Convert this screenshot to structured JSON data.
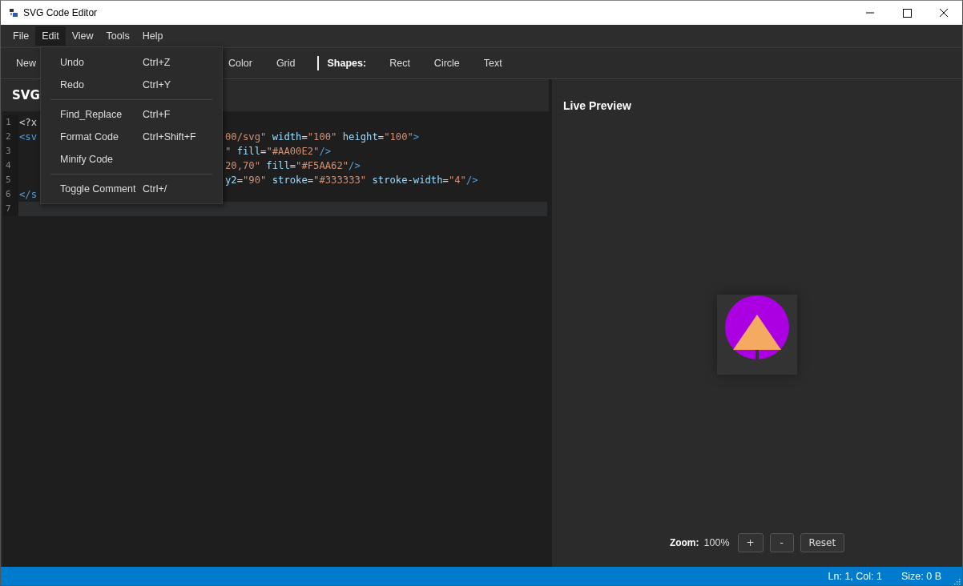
{
  "window": {
    "title": "SVG Code Editor"
  },
  "menu_bar": [
    {
      "label": "File",
      "selected": false
    },
    {
      "label": "Edit",
      "selected": true
    },
    {
      "label": "View",
      "selected": false
    },
    {
      "label": "Tools",
      "selected": false
    },
    {
      "label": "Help",
      "selected": false
    }
  ],
  "toolbar": [
    {
      "kind": "button",
      "label": "New"
    },
    {
      "kind": "gap"
    },
    {
      "kind": "button",
      "label": "Color"
    },
    {
      "kind": "button",
      "label": "Grid"
    },
    {
      "kind": "separator"
    },
    {
      "kind": "heading",
      "label": "Shapes:"
    },
    {
      "kind": "button",
      "label": "Rect"
    },
    {
      "kind": "button",
      "label": "Circle"
    },
    {
      "kind": "button",
      "label": "Text"
    }
  ],
  "editor": {
    "title": "SVG",
    "lines": [
      {
        "number": "1",
        "current": false,
        "left": [
          {
            "kind": "punct",
            "text": "<?x"
          }
        ]
      },
      {
        "number": "2",
        "current": false,
        "left": [
          {
            "kind": "tag",
            "text": "<sv"
          }
        ],
        "right": [
          {
            "kind": "value",
            "text": "00/svg\""
          },
          {
            "kind": "attr",
            "text": " width"
          },
          {
            "kind": "punct",
            "text": "="
          },
          {
            "kind": "value",
            "text": "\"100\""
          },
          {
            "kind": "attr",
            "text": " height"
          },
          {
            "kind": "punct",
            "text": "="
          },
          {
            "kind": "value",
            "text": "\"100\""
          },
          {
            "kind": "tag",
            "text": ">"
          }
        ]
      },
      {
        "number": "3",
        "current": false,
        "right": [
          {
            "kind": "value",
            "text": "\""
          },
          {
            "kind": "attr",
            "text": " fill"
          },
          {
            "kind": "punct",
            "text": "="
          },
          {
            "kind": "value",
            "text": "\"#AA00E2\""
          },
          {
            "kind": "tag",
            "text": "/>"
          }
        ]
      },
      {
        "number": "4",
        "current": false,
        "right": [
          {
            "kind": "value",
            "text": "20,70\""
          },
          {
            "kind": "attr",
            "text": " fill"
          },
          {
            "kind": "punct",
            "text": "="
          },
          {
            "kind": "value",
            "text": "\"#F5AA62\""
          },
          {
            "kind": "tag",
            "text": "/>"
          }
        ]
      },
      {
        "number": "5",
        "current": false,
        "right": [
          {
            "kind": "attr",
            "text": "y2"
          },
          {
            "kind": "punct",
            "text": "="
          },
          {
            "kind": "value",
            "text": "\"90\""
          },
          {
            "kind": "attr",
            "text": " stroke"
          },
          {
            "kind": "punct",
            "text": "="
          },
          {
            "kind": "value",
            "text": "\"#333333\""
          },
          {
            "kind": "attr",
            "text": " stroke-width"
          },
          {
            "kind": "punct",
            "text": "="
          },
          {
            "kind": "value",
            "text": "\"4\""
          },
          {
            "kind": "tag",
            "text": "/>"
          }
        ]
      },
      {
        "number": "6",
        "current": false,
        "left": [
          {
            "kind": "tag",
            "text": "</s"
          }
        ]
      },
      {
        "number": "7",
        "current": true
      }
    ]
  },
  "edit_menu": [
    {
      "kind": "item",
      "label": "Undo",
      "shortcut": "Ctrl+Z"
    },
    {
      "kind": "item",
      "label": "Redo",
      "shortcut": "Ctrl+Y"
    },
    {
      "kind": "separator"
    },
    {
      "kind": "item",
      "label": "Find_Replace",
      "shortcut": "Ctrl+F"
    },
    {
      "kind": "item",
      "label": "Format Code",
      "shortcut": "Ctrl+Shift+F"
    },
    {
      "kind": "item",
      "label": "Minify Code"
    },
    {
      "kind": "separator"
    },
    {
      "kind": "item",
      "label": "Toggle Comment",
      "shortcut": "Ctrl+/"
    }
  ],
  "preview": {
    "title": "Live Preview",
    "zoom_label": "Zoom:",
    "zoom_value": "100%",
    "buttons": [
      "+",
      "-",
      "Reset"
    ]
  },
  "status_bar": {
    "position": "Ln: 1, Col: 1",
    "size": "Size: 0 B"
  }
}
